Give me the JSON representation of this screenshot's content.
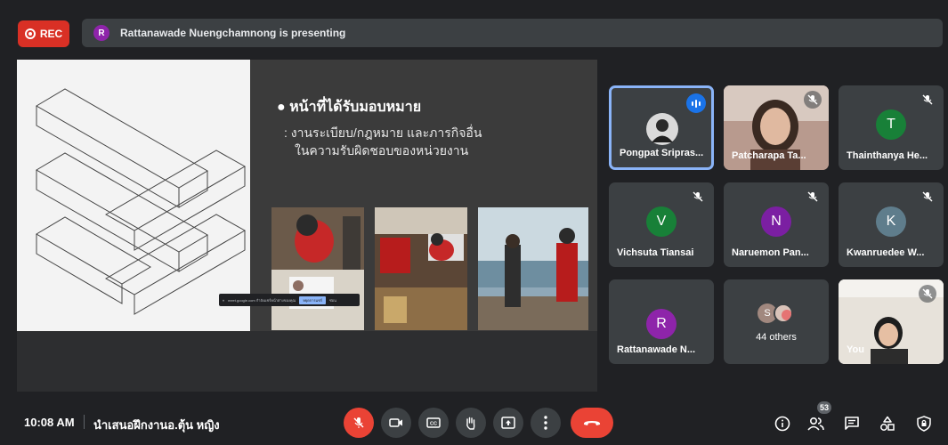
{
  "recording": {
    "label": "REC"
  },
  "presenter": {
    "initial": "R",
    "text": "Rattanawade Nuengchamnong is presenting"
  },
  "slide": {
    "bullet_title": "หน้าที่ได้รับมอบหมาย",
    "bullet_line1": ": งานระเบียบ/กฎหมาย และภารกิจอื่น",
    "bullet_line2": "ในความรับผิดชอบของหน่วยงาน",
    "share_banner_text": "meet.google.com กำลังแชร์หน้าต่างของคุณ",
    "share_banner_stop": "หยุดการแชร์",
    "share_banner_hide": "ซ่อน"
  },
  "participants": [
    {
      "name": "Pongpat Sripras...",
      "speaking": true
    },
    {
      "name": "Patcharapa Ta...",
      "muted": true
    },
    {
      "name": "Thainthanya He...",
      "initial": "T",
      "color": "#188038",
      "muted": true
    },
    {
      "name": "Vichsuta Tiansai",
      "initial": "V",
      "color": "#188038",
      "muted": true
    },
    {
      "name": "Naruemon Pan...",
      "initial": "N",
      "color": "#7b1fa2",
      "muted": true
    },
    {
      "name": "Kwanruedee W...",
      "initial": "K",
      "color": "#5f7d8c",
      "muted": true
    },
    {
      "name": "Rattanawade N...",
      "initial": "R",
      "color": "#8e24aa"
    },
    {
      "name": "44 others",
      "initial": "S"
    },
    {
      "name": "You",
      "muted": true
    }
  ],
  "bottom_bar": {
    "time": "10:08 AM",
    "meeting_name": "นำเสนอฝึกงานอ.ตุ้น หญิง",
    "participant_count": "53"
  },
  "colors": {
    "accent": "#8ab4f8",
    "danger": "#ea4335",
    "background": "#202124",
    "tile": "#3c4043"
  }
}
